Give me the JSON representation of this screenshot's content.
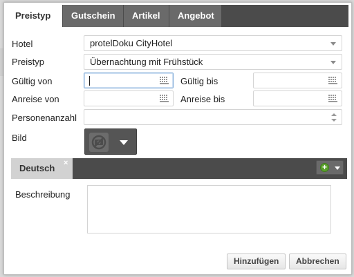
{
  "tabs": [
    {
      "label": "Preistyp",
      "active": true
    },
    {
      "label": "Gutschein",
      "active": false
    },
    {
      "label": "Artikel",
      "active": false
    },
    {
      "label": "Angebot",
      "active": false
    }
  ],
  "form": {
    "hotel_label": "Hotel",
    "hotel_value": "protelDoku CityHotel",
    "preistyp_label": "Preistyp",
    "preistyp_value": "Übernachtung mit Frühstück",
    "gueltig_von_label": "Gültig von",
    "gueltig_von_value": "",
    "gueltig_bis_label": "Gültig bis",
    "gueltig_bis_value": "",
    "anreise_von_label": "Anreise von",
    "anreise_von_value": "",
    "anreise_bis_label": "Anreise bis",
    "anreise_bis_value": "",
    "personenanzahl_label": "Personenanzahl",
    "personenanzahl_value": "",
    "bild_label": "Bild"
  },
  "language_tabs": [
    {
      "label": "Deutsch",
      "close": "×"
    }
  ],
  "beschreibung_label": "Beschreibung",
  "buttons": {
    "add": "Hinzufügen",
    "cancel": "Abbrechen"
  },
  "colors": {
    "tabbar": "#4b4b4b",
    "tab_inactive": "#6a6a6a",
    "add_icon": "#5aa02c"
  },
  "icons": [
    "calendar-icon",
    "chevron-down-icon",
    "spinner-icon",
    "no-image-icon",
    "add-icon"
  ]
}
